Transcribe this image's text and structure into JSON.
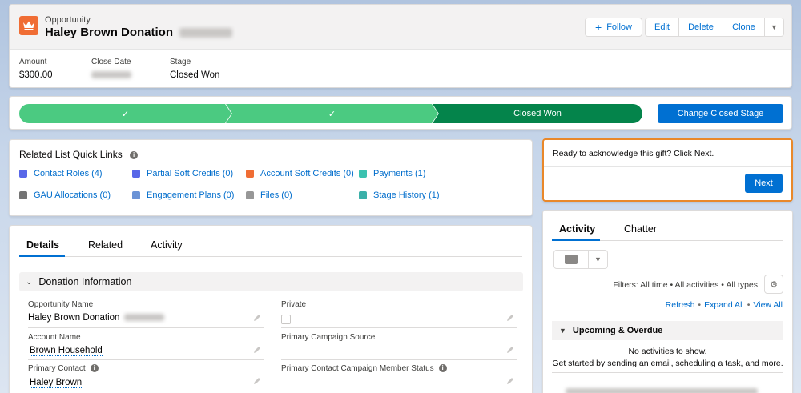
{
  "header": {
    "object_type": "Opportunity",
    "title": "Haley Brown Donation",
    "actions": {
      "follow": "Follow",
      "edit": "Edit",
      "delete": "Delete",
      "clone": "Clone"
    },
    "fields": [
      {
        "label": "Amount",
        "value": "$300.00"
      },
      {
        "label": "Close Date",
        "value": ""
      },
      {
        "label": "Stage",
        "value": "Closed Won"
      }
    ]
  },
  "path": {
    "stages": [
      "",
      "",
      "Closed Won"
    ],
    "change_button": "Change Closed Stage",
    "colors": {
      "complete": "#4bca81",
      "current": "#04844b"
    }
  },
  "quick_links": {
    "title": "Related List Quick Links",
    "items": [
      {
        "label": "Contact Roles (4)",
        "icon": "contact-roles-icon",
        "color": "#5867e8"
      },
      {
        "label": "Partial Soft Credits (0)",
        "icon": "partial-soft-credits-icon",
        "color": "#5867e8"
      },
      {
        "label": "Account Soft Credits (0)",
        "icon": "account-soft-credits-icon",
        "color": "#f06d34"
      },
      {
        "label": "Payments (1)",
        "icon": "payments-icon",
        "color": "#3bc2b0"
      },
      {
        "label": "GAU Allocations (0)",
        "icon": "gau-allocations-icon",
        "color": "#747474"
      },
      {
        "label": "Engagement Plans (0)",
        "icon": "engagement-plans-icon",
        "color": "#6b93d6"
      },
      {
        "label": "Files (0)",
        "icon": "files-icon",
        "color": "#979797"
      },
      {
        "label": "Stage History (1)",
        "icon": "stage-history-icon",
        "color": "#3bb0a9"
      }
    ]
  },
  "guidance": {
    "text": "Ready to acknowledge this gift? Click Next.",
    "next": "Next"
  },
  "details": {
    "tabs": [
      "Details",
      "Related",
      "Activity"
    ],
    "section": "Donation Information",
    "fields": {
      "opportunity_name": {
        "label": "Opportunity Name",
        "value": "Haley Brown Donation"
      },
      "private": {
        "label": "Private"
      },
      "account_name": {
        "label": "Account Name",
        "value": "Brown Household"
      },
      "campaign_source": {
        "label": "Primary Campaign Source"
      },
      "primary_contact": {
        "label": "Primary Contact",
        "value": "Haley Brown"
      },
      "contact_campaign_status": {
        "label": "Primary Contact Campaign Member Status"
      }
    }
  },
  "activity": {
    "tabs": [
      "Activity",
      "Chatter"
    ],
    "filters": "Filters: All time • All activities • All types",
    "refresh": "Refresh",
    "expand_all": "Expand All",
    "view_all": "View All",
    "upcoming": "Upcoming & Overdue",
    "empty_title": "No activities to show.",
    "empty_sub": "Get started by sending an email, scheduling a task, and more."
  }
}
